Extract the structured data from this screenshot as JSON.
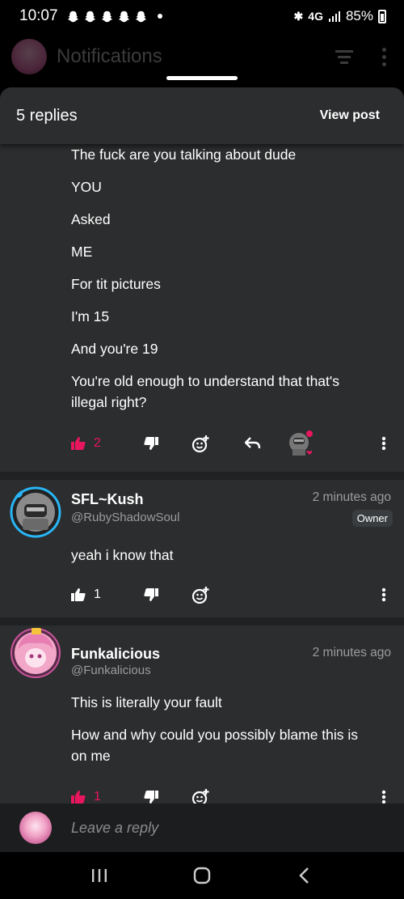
{
  "status_bar": {
    "time": "10:07",
    "network": "4G",
    "battery": "85%",
    "icons": [
      "snapchat-icon",
      "snapchat-icon",
      "snapchat-icon",
      "snapchat-icon",
      "snapchat-icon",
      "notification-dot",
      "bluetooth-icon",
      "signal-icon",
      "battery-icon"
    ]
  },
  "app_header": {
    "title": "Notifications"
  },
  "sheet": {
    "replies_label": "5 replies",
    "view_post_label": "View post"
  },
  "first_message": {
    "lines": [
      "The fuck are you talking about dude",
      "YOU",
      "Asked",
      "ME",
      "For tit pictures",
      "I'm 15",
      "And you're 19",
      "You're old enough to understand that that's",
      "illegal right?"
    ],
    "likes": "2"
  },
  "comments": [
    {
      "name": "SFL~Kush",
      "handle": "@RubyShadowSoul",
      "time": "2 minutes ago",
      "badge": "Owner",
      "lines": [
        "yeah i know that"
      ],
      "likes": "1"
    },
    {
      "name": "Funkalicious",
      "handle": "@Funkalicious",
      "time": "2 minutes ago",
      "lines": [
        "This is literally your fault",
        "How and why could you possibly blame this is",
        "on me"
      ],
      "likes": "1"
    }
  ],
  "reply_bar": {
    "placeholder": "Leave a reply"
  },
  "colors": {
    "accent_pink": "#e8175d",
    "sheet_bg": "#2b2d2e",
    "muted_text": "#9a9c9e"
  }
}
